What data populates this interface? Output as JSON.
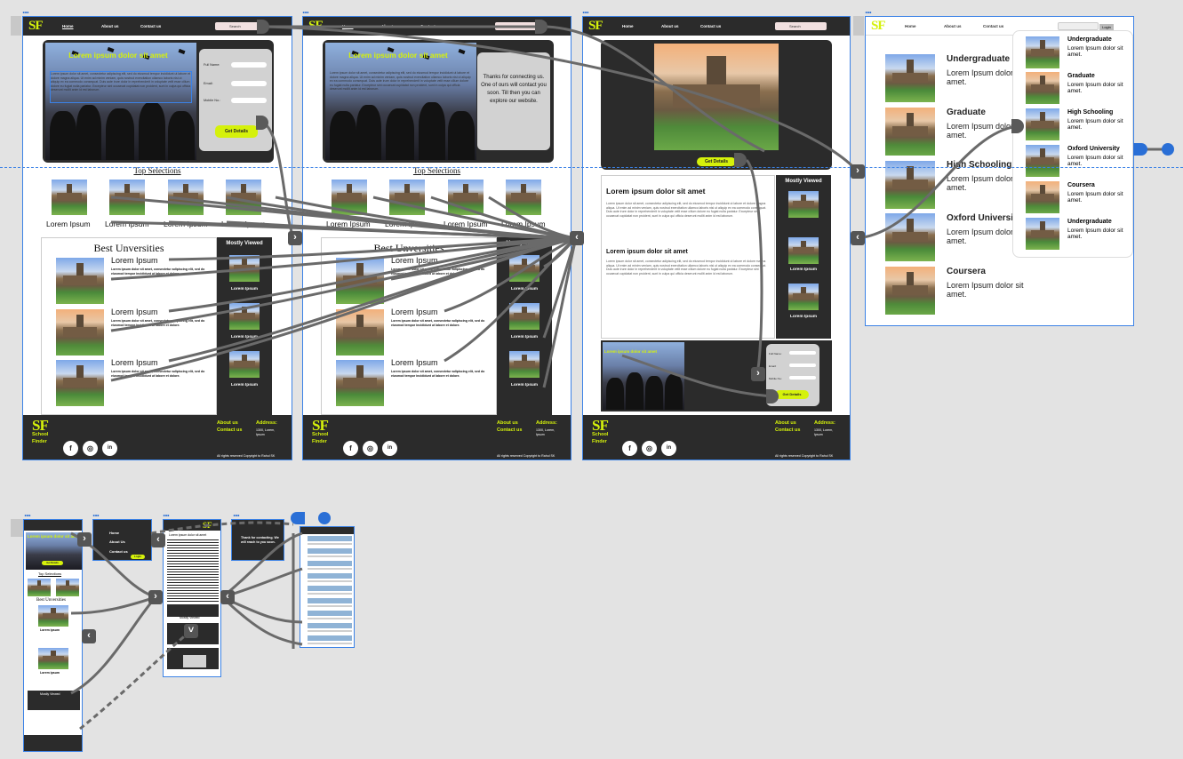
{
  "brand": {
    "logo": "SF",
    "accent": "#d5f10b",
    "dark": "#2b2b2b",
    "frame_border": "#3b82e6"
  },
  "nav": {
    "home": "Home",
    "about": "About us",
    "contact": "Contact us",
    "search": "Search",
    "login": "Login"
  },
  "hero": {
    "title": "Lorem ipsum dolor sit amet",
    "body": "Lorem ipsum dolor sit amet, consectetur adipiscing elit, sed do eiusmod tempor incididunt ut labore et dolore magna aliqua. Ut enim ad minim veniam, quis nostrud exercitation ullamco laboris nisi ut aliquip ex ea commodo consequat. Duis aute irure dolor in reprehenderit in voluptate velit esse cillum dolore eu fugiat nulla pariatur. Excepteur sint occaecat cupidatat non proident, sunt in culpa qui officia deserunt mollit anim id est laborum."
  },
  "form": {
    "full_name": "Full Name:",
    "email": "Email:",
    "mobile": "Mobile No.:",
    "cta": "Get Details"
  },
  "thanks": {
    "text": "Thanks for connecting us. One of ours will contact you soon. Till then you can explore our website."
  },
  "sections": {
    "top_selections": "Top Selections",
    "best_universities": "Best Unversities",
    "mostly_viewed": "Mostly Viewed"
  },
  "cards": {
    "lorem": "Lorem Ipsum",
    "desc": "Lorem ipsum dolor sit amet, consectetur adipiscing elit, sed do eiusmod tempor incididunt ut labore et dolore."
  },
  "detail": {
    "cta": "Get Details",
    "h1": "Lorem ipsum dolor sit amet",
    "h2": "Lorem ipsum dolor sit amet",
    "p": "Lorem ipsum dolor sit amet, consectetur adipiscing elit, sed do eiusmod tempor incididunt ut labore et dolore magna aliqua. Ut enim ad minim veniam, quis nostrud exercitation ullamco laboris nisi ut aliquip ex ea commodo consequat. Duis aute irure dolor in reprehenderit in voluptate velit esse cillum dolore eu fugiat nulla pariatur. Excepteur sint occaecat cupidatat non proident, sunt in culpa qui officia deserunt mollit anim id est laborum."
  },
  "footer": {
    "school": "School",
    "finder": "Finder",
    "about": "About us",
    "contact": "Contact us",
    "address_label": "Address:",
    "address": "1300, Lorem, Ipsum",
    "copyright": "All rights reserved Copyright to Rahul SK",
    "social": [
      "f",
      "◎",
      "in"
    ]
  },
  "programs": [
    {
      "name": "Undergraduate",
      "desc": "Lorem Ipsum dolor sit amet."
    },
    {
      "name": "Graduate",
      "desc": "Lorem Ipsum dolor sit amet."
    },
    {
      "name": "High Schooling",
      "desc": "Lorem Ipsum dolor sit amet."
    },
    {
      "name": "Oxford University",
      "desc": "Lorem Ipsum dolor sit amet."
    },
    {
      "name": "Coursera",
      "desc": "Lorem Ipsum dolor sit amet."
    }
  ],
  "popover": [
    {
      "name": "Undergraduate",
      "desc": "Lorem Ipsum dolor sit amet."
    },
    {
      "name": "Graduate",
      "desc": "Lorem Ipsum dolor sit amet."
    },
    {
      "name": "High Schooling",
      "desc": "Lorem Ipsum dolor sit amet."
    },
    {
      "name": "Oxford University",
      "desc": "Lorem Ipsum dolor sit amet."
    },
    {
      "name": "Coursera",
      "desc": "Lorem Ipsum dolor sit amet."
    },
    {
      "name": "Undergraduate",
      "desc": "Lorem Ipsum dolor sit amet."
    }
  ],
  "mobile": {
    "home": "Home",
    "about": "About Us",
    "contact": "Contact us",
    "login": "Login",
    "thanks": "Thank for contacting. We will reach to you soon.",
    "title": "Lorem ipsum dolor sit amet",
    "cta": "Get Details",
    "mostly_viewed": "Mostly Viewed",
    "top": "Top Selections",
    "best": "Best Unversities",
    "lorem": "Lorem ipsum"
  }
}
